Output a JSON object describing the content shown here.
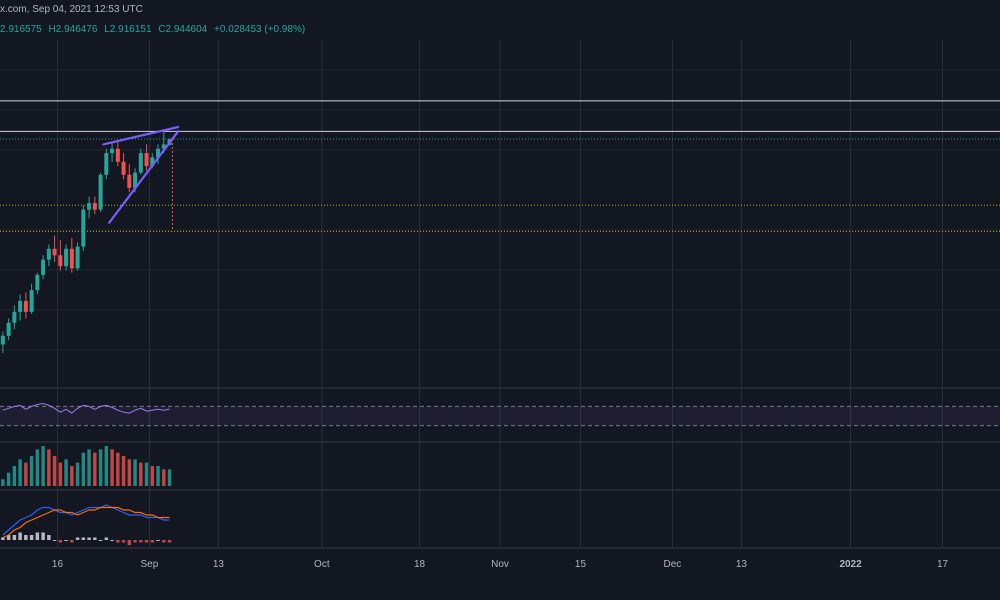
{
  "header": {
    "source_time": "x.com, Sep 04, 2021 12:53 UTC"
  },
  "ohlc": {
    "open": "2.916575",
    "high_label": "H",
    "high": "2.946476",
    "low_label": "L",
    "low": "2.916151",
    "close_label": "C",
    "close": "2.944604",
    "change": "+0.028453 (+0.98%)"
  },
  "colors": {
    "background": "#131722",
    "grid": "#2a2e39",
    "up": "#26a69a",
    "down": "#ef5350",
    "pattern": "#7b5cff",
    "rsi": "#9c7cf0",
    "rsi_band": "#7e57c2",
    "macd": "#2962ff",
    "signal": "#ff6d00",
    "text": "#b2b5be",
    "level_white": "#d1d4dc",
    "level_yellow": "#c9a227",
    "level_teal": "#26a69a"
  },
  "chart_data": {
    "type": "candlestick",
    "x_axis": {
      "ticks": [
        {
          "label": "16",
          "date": "2021-08-16"
        },
        {
          "label": "Sep",
          "date": "2021-09-01"
        },
        {
          "label": "13",
          "date": "2021-09-13"
        },
        {
          "label": "Oct",
          "date": "2021-10-01"
        },
        {
          "label": "18",
          "date": "2021-10-18"
        },
        {
          "label": "Nov",
          "date": "2021-11-01"
        },
        {
          "label": "15",
          "date": "2021-11-15"
        },
        {
          "label": "Dec",
          "date": "2021-12-01"
        },
        {
          "label": "13",
          "date": "2021-12-13"
        },
        {
          "label": "2022",
          "date": "2022-01-01"
        },
        {
          "label": "17",
          "date": "2022-01-17"
        }
      ],
      "range": [
        "2021-08-06",
        "2022-01-27"
      ]
    },
    "price_range": [
      1.8,
      3.4
    ],
    "candles": [
      {
        "d": "2021-08-06",
        "o": 2.0,
        "h": 2.06,
        "l": 1.96,
        "c": 2.04
      },
      {
        "d": "2021-08-07",
        "o": 2.04,
        "h": 2.12,
        "l": 2.02,
        "c": 2.1
      },
      {
        "d": "2021-08-08",
        "o": 2.1,
        "h": 2.18,
        "l": 2.07,
        "c": 2.15
      },
      {
        "d": "2021-08-09",
        "o": 2.15,
        "h": 2.23,
        "l": 2.11,
        "c": 2.2
      },
      {
        "d": "2021-08-10",
        "o": 2.2,
        "h": 2.24,
        "l": 2.12,
        "c": 2.15
      },
      {
        "d": "2021-08-11",
        "o": 2.15,
        "h": 2.28,
        "l": 2.14,
        "c": 2.25
      },
      {
        "d": "2021-08-12",
        "o": 2.25,
        "h": 2.33,
        "l": 2.23,
        "c": 2.32
      },
      {
        "d": "2021-08-13",
        "o": 2.32,
        "h": 2.41,
        "l": 2.3,
        "c": 2.39
      },
      {
        "d": "2021-08-14",
        "o": 2.39,
        "h": 2.46,
        "l": 2.36,
        "c": 2.44
      },
      {
        "d": "2021-08-15",
        "o": 2.44,
        "h": 2.5,
        "l": 2.38,
        "c": 2.41
      },
      {
        "d": "2021-08-16",
        "o": 2.41,
        "h": 2.48,
        "l": 2.34,
        "c": 2.36
      },
      {
        "d": "2021-08-17",
        "o": 2.36,
        "h": 2.46,
        "l": 2.34,
        "c": 2.44
      },
      {
        "d": "2021-08-18",
        "o": 2.44,
        "h": 2.49,
        "l": 2.33,
        "c": 2.35
      },
      {
        "d": "2021-08-19",
        "o": 2.35,
        "h": 2.47,
        "l": 2.34,
        "c": 2.45
      },
      {
        "d": "2021-08-20",
        "o": 2.45,
        "h": 2.64,
        "l": 2.43,
        "c": 2.62
      },
      {
        "d": "2021-08-21",
        "o": 2.62,
        "h": 2.68,
        "l": 2.58,
        "c": 2.65
      },
      {
        "d": "2021-08-22",
        "o": 2.65,
        "h": 2.68,
        "l": 2.6,
        "c": 2.62
      },
      {
        "d": "2021-08-23",
        "o": 2.62,
        "h": 2.79,
        "l": 2.61,
        "c": 2.78
      },
      {
        "d": "2021-08-24",
        "o": 2.78,
        "h": 2.9,
        "l": 2.76,
        "c": 2.88
      },
      {
        "d": "2021-08-25",
        "o": 2.88,
        "h": 2.93,
        "l": 2.84,
        "c": 2.9
      },
      {
        "d": "2021-08-26",
        "o": 2.9,
        "h": 2.93,
        "l": 2.82,
        "c": 2.84
      },
      {
        "d": "2021-08-27",
        "o": 2.84,
        "h": 2.88,
        "l": 2.76,
        "c": 2.78
      },
      {
        "d": "2021-08-28",
        "o": 2.78,
        "h": 2.83,
        "l": 2.7,
        "c": 2.72
      },
      {
        "d": "2021-08-29",
        "o": 2.72,
        "h": 2.81,
        "l": 2.7,
        "c": 2.79
      },
      {
        "d": "2021-08-30",
        "o": 2.79,
        "h": 2.9,
        "l": 2.78,
        "c": 2.88
      },
      {
        "d": "2021-08-31",
        "o": 2.88,
        "h": 2.92,
        "l": 2.8,
        "c": 2.82
      },
      {
        "d": "2021-09-01",
        "o": 2.82,
        "h": 2.88,
        "l": 2.81,
        "c": 2.86
      },
      {
        "d": "2021-09-02",
        "o": 2.86,
        "h": 2.92,
        "l": 2.83,
        "c": 2.9
      },
      {
        "d": "2021-09-03",
        "o": 2.9,
        "h": 2.98,
        "l": 2.88,
        "c": 2.92
      },
      {
        "d": "2021-09-04",
        "o": 2.917,
        "h": 2.946,
        "l": 2.916,
        "c": 2.945
      }
    ],
    "levels": [
      {
        "name": "resistance-upper",
        "price": 3.12,
        "style": "solid",
        "color": "level_white"
      },
      {
        "name": "resistance-lower",
        "price": 2.98,
        "style": "solid",
        "color": "level_white"
      },
      {
        "name": "current-price",
        "price": 2.945,
        "style": "dotted",
        "color": "level_teal"
      },
      {
        "name": "support-upper",
        "price": 2.64,
        "style": "dotted",
        "color": "level_yellow"
      },
      {
        "name": "support-lower",
        "price": 2.52,
        "style": "dotted",
        "color": "level_yellow"
      }
    ],
    "wedge": {
      "upper": [
        {
          "d": "2021-08-24",
          "p": 2.92
        },
        {
          "d": "2021-09-06",
          "p": 3.0
        }
      ],
      "lower": [
        {
          "d": "2021-08-25",
          "p": 2.56
        },
        {
          "d": "2021-09-06",
          "p": 2.98
        }
      ]
    },
    "target_drop": {
      "d": "2021-09-05",
      "from": 2.945,
      "to": 2.52
    },
    "rsi": {
      "range": [
        0,
        100
      ],
      "band": [
        30,
        70
      ],
      "values": [
        62,
        66,
        70,
        72,
        64,
        70,
        74,
        76,
        72,
        66,
        58,
        64,
        56,
        66,
        72,
        70,
        64,
        70,
        72,
        68,
        62,
        58,
        56,
        62,
        66,
        60,
        62,
        64,
        62,
        64
      ]
    },
    "histogram": {
      "values": [
        0.02,
        0.04,
        0.06,
        0.08,
        0.07,
        0.09,
        0.11,
        0.12,
        0.11,
        0.09,
        0.07,
        0.08,
        0.06,
        0.07,
        0.1,
        0.11,
        0.1,
        0.11,
        0.12,
        0.11,
        0.1,
        0.09,
        0.08,
        0.08,
        0.07,
        0.07,
        0.06,
        0.06,
        0.05,
        0.05
      ]
    },
    "macd": {
      "macd": [
        0.02,
        0.04,
        0.06,
        0.08,
        0.09,
        0.1,
        0.12,
        0.13,
        0.13,
        0.12,
        0.11,
        0.11,
        0.1,
        0.11,
        0.12,
        0.13,
        0.13,
        0.13,
        0.14,
        0.13,
        0.12,
        0.11,
        0.1,
        0.1,
        0.1,
        0.09,
        0.09,
        0.09,
        0.08,
        0.08
      ],
      "signal": [
        0.01,
        0.02,
        0.04,
        0.05,
        0.07,
        0.08,
        0.09,
        0.1,
        0.11,
        0.12,
        0.12,
        0.11,
        0.11,
        0.1,
        0.11,
        0.12,
        0.12,
        0.13,
        0.13,
        0.13,
        0.13,
        0.12,
        0.12,
        0.11,
        0.11,
        0.1,
        0.1,
        0.09,
        0.09,
        0.09
      ],
      "hist": [
        0.01,
        0.02,
        0.02,
        0.03,
        0.02,
        0.02,
        0.03,
        0.03,
        0.02,
        0.0,
        -0.01,
        0.0,
        -0.01,
        0.01,
        0.01,
        0.01,
        0.01,
        0.0,
        0.01,
        0.0,
        -0.01,
        -0.01,
        -0.02,
        -0.01,
        -0.01,
        -0.01,
        -0.01,
        0.0,
        -0.01,
        -0.01
      ]
    }
  }
}
